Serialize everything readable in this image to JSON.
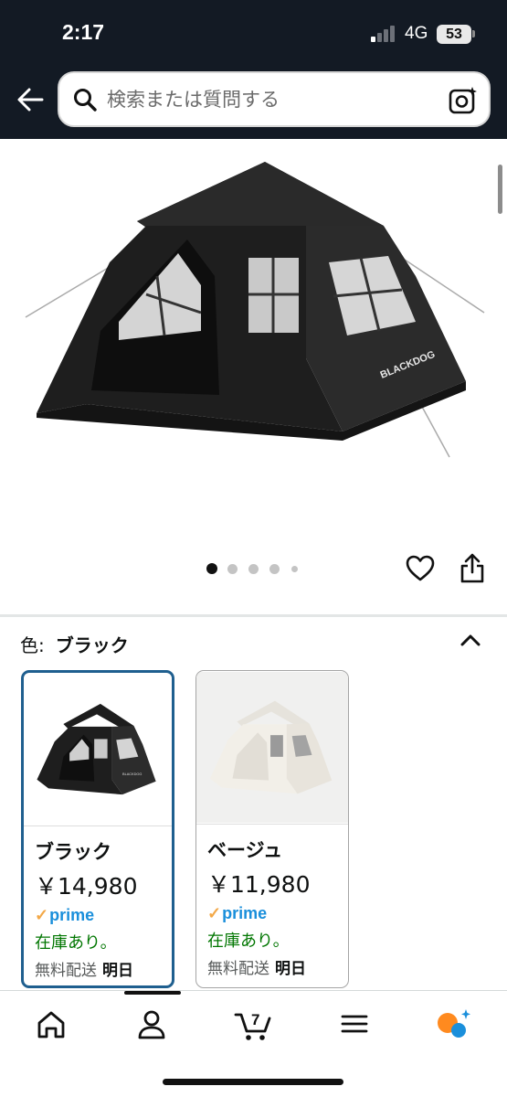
{
  "status_bar": {
    "time": "2:17",
    "network": "4G",
    "battery": "53"
  },
  "search": {
    "placeholder": "検索または質問する",
    "back_icon": "back-arrow-icon",
    "search_icon": "search-icon",
    "lens_icon": "camera-lens-icon"
  },
  "product": {
    "image_alt": "black pop-up tent",
    "brand_mark": "BLACKDOG",
    "carousel": {
      "count": 5,
      "active": 0
    }
  },
  "actions": {
    "favorite_icon": "heart-icon",
    "share_icon": "share-icon"
  },
  "color_selector": {
    "label": "色:",
    "selected": "ブラック",
    "variants": [
      {
        "name": "ブラック",
        "price": "￥14,980",
        "prime": "prime",
        "stock": "在庫あり。",
        "shipping": "無料配送",
        "shipping_day": "明日",
        "selected": true
      },
      {
        "name": "ベージュ",
        "price": "￥11,980",
        "prime": "prime",
        "stock": "在庫あり。",
        "shipping": "無料配送",
        "shipping_day": "明日",
        "selected": false
      }
    ]
  },
  "bottom_nav": {
    "items": [
      "home-icon",
      "account-icon",
      "cart-icon",
      "menu-icon",
      "rufus-ai-icon"
    ],
    "cart_count": "7"
  },
  "colors": {
    "header_bg": "#131a24",
    "selected_border": "#1f5f8f",
    "stock_green": "#007600",
    "prime_blue": "#1a8fdb",
    "prime_check": "#f3a847"
  }
}
